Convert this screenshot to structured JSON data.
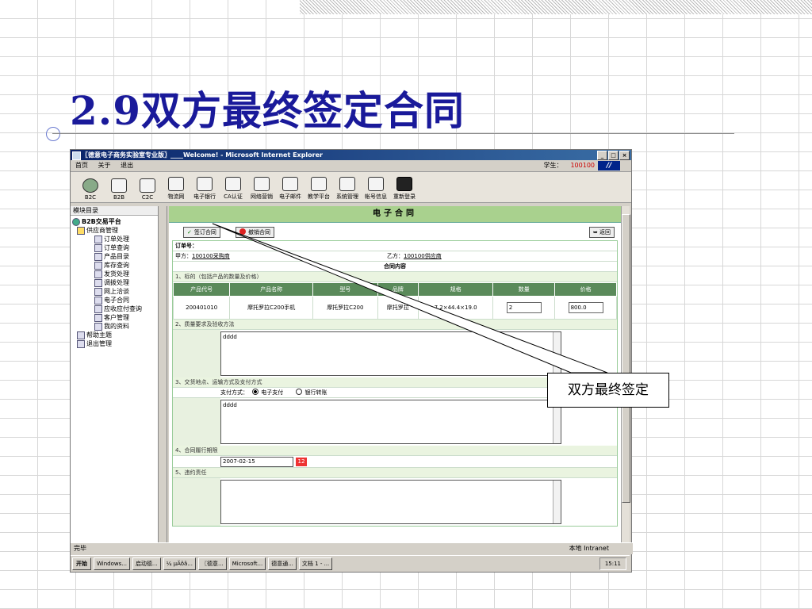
{
  "slide": {
    "title": "2.9双方最终签定合同",
    "callout": "双方最终签定"
  },
  "window": {
    "title": "〖德意电子商务实验室专业版〗____Welcome! - Microsoft Internet Explorer",
    "buttons": [
      "_",
      "□",
      "×"
    ],
    "menu": [
      "首页",
      "关于",
      "退出"
    ],
    "user_label": "学生：",
    "user_id": "100100",
    "toolbar": [
      "B2C",
      "B2B",
      "C2C",
      "物流网",
      "电子银行",
      "CA认证",
      "网络营销",
      "电子邮件",
      "教学平台",
      "系统管理",
      "帐号信息",
      "重新登录"
    ],
    "exit_label": "EXIT"
  },
  "sidebar": {
    "heading": "模块目录",
    "root": "B2B交易平台",
    "folder": "供应商管理",
    "items": [
      "订单处理",
      "订单查询",
      "产品目录",
      "库存查询",
      "发货处理",
      "调拨处理",
      "网上洽谈",
      "电子合同",
      "应收应付查询",
      "客户管理",
      "我的资料"
    ],
    "help": "帮助主题",
    "logout": "退出管理"
  },
  "contract": {
    "header": "电子合同",
    "sign_button": "签订合同",
    "cancel_button": "撤销合同",
    "back_button": "返回",
    "order_label": "订单号：",
    "party_a_label": "甲方：",
    "party_a": "100100采购商",
    "party_b_label": "乙方：",
    "party_b": "100100供应商",
    "content_title": "合同内容",
    "section1": "1、标的（包括产品的数量及价格）",
    "columns": [
      "产品代号",
      "产品名称",
      "型号",
      "品牌",
      "规格",
      "数量",
      "价格"
    ],
    "item": {
      "code": "200401010",
      "name": "摩托罗拉C200手机",
      "model": "摩托罗拉C200",
      "brand": "摩托罗拉",
      "spec": "7.2×44.4×19.0",
      "qty": "2",
      "price": "800.0"
    },
    "section2": "2、质量要求及验收方法",
    "quality_text": "dddd",
    "section3": "3、交货地点、运输方式及支付方式",
    "pay_label": "支付方式：",
    "pay_option1": "电子支付",
    "pay_option2": "银行转账",
    "delivery_text": "dddd",
    "section4": "4、合同履行期限",
    "term_date": "2007-02-15",
    "section5": "5、违约责任"
  },
  "status": {
    "left": "完毕",
    "zone": "本地 Intranet"
  },
  "taskbar": {
    "start": "开始",
    "tasks": [
      "Windows...",
      "启动德...",
      "¼ µÄõã...",
      "〖德意...",
      "Microsoft...",
      "德意通...",
      "文档 1 - ..."
    ],
    "clock": "15:11"
  }
}
